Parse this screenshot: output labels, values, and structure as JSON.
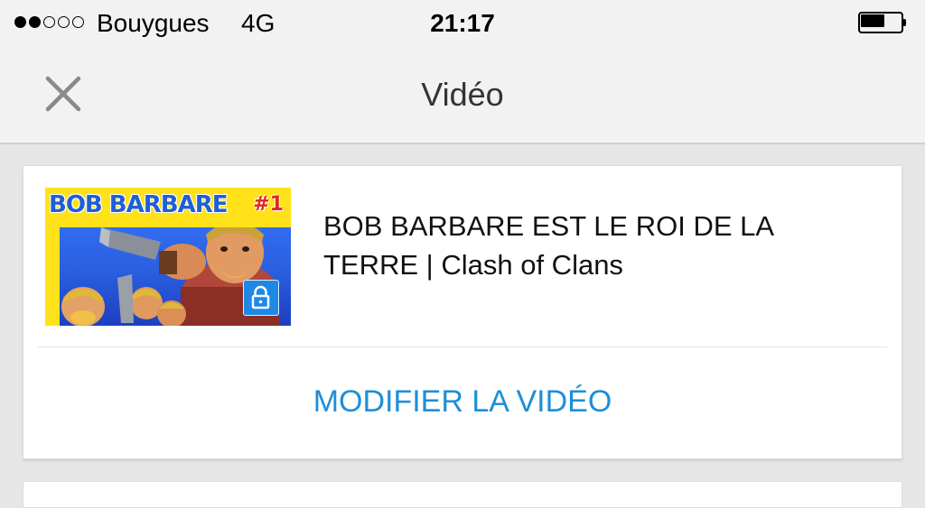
{
  "status_bar": {
    "signal_filled": 2,
    "signal_total": 5,
    "carrier": "Bouygues",
    "network": "4G",
    "time": "21:17",
    "battery_level": 0.6
  },
  "nav": {
    "title": "Vidéo",
    "close_icon": "close-x-icon"
  },
  "video_card": {
    "thumbnail": {
      "title_text": "BOB BARBARE",
      "episode": "#1",
      "lock_icon": "lock-icon"
    },
    "title": "BOB BARBARE EST LE ROI DE LA TERRE | Clash of Clans",
    "edit_label": "MODIFIER LA VIDÉO"
  },
  "colors": {
    "accent": "#1e8ed8",
    "lock_badge": "#1e88e5",
    "background": "#e6e6e6",
    "nav_bg": "#f2f2f2"
  }
}
